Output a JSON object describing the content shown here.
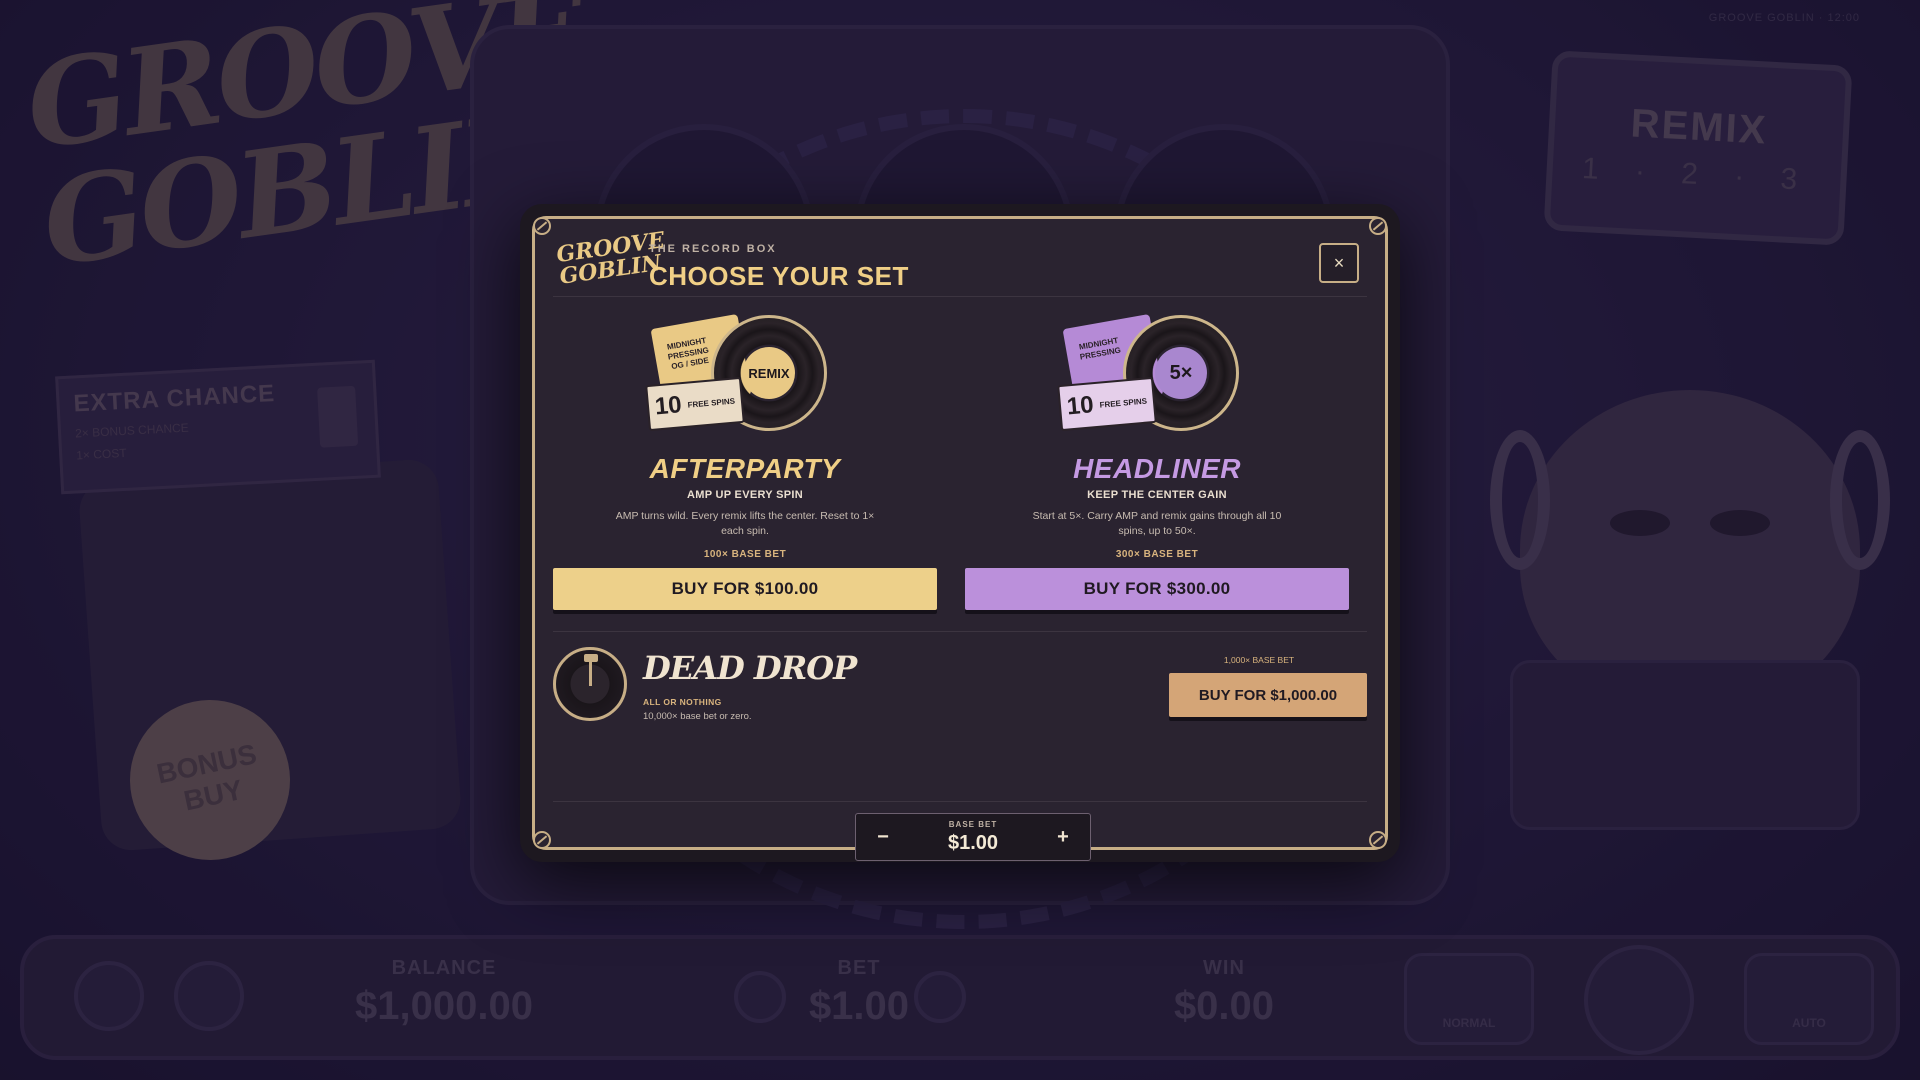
{
  "background": {
    "logo": "GROOVE GOBLIN",
    "extra_chance": {
      "title": "EXTRA CHANCE",
      "line1": "2× BONUS CHANCE",
      "line2": "1× COST"
    },
    "remix_panel": {
      "title": "REMIX",
      "steps": "1 · 2 · 3"
    },
    "bonus_buy": "BONUS BUY",
    "top_right": "GROOVE GOBLIN  ·  12:00",
    "hud": {
      "balance_label": "BALANCE",
      "balance_value": "$1,000.00",
      "bet_label": "BET",
      "bet_value": "$1.00",
      "win_label": "WIN",
      "win_value": "$0.00",
      "normal_label": "NORMAL",
      "auto_label": "AUTO"
    }
  },
  "modal": {
    "logo_text": "GROOVE GOBLIN",
    "subtitle": "THE RECORD BOX",
    "title": "CHOOSE YOUR SET",
    "close_icon": "×",
    "colors": {
      "gold": "#f0cf86",
      "lavender": "#c59ae3",
      "tan": "#d4a577",
      "frame": "#c7ae86"
    },
    "options": [
      {
        "id": "afterparty",
        "sleeve_text": "MIDNIGHT PRESSING OG / SIDE",
        "record_label": "REMIX",
        "tag_count": "10",
        "tag_label": "FREE SPINS",
        "title": "AFTERPARTY",
        "subtitle": "AMP UP EVERY SPIN",
        "description": "AMP turns wild. Every remix lifts the center. Reset to 1× each spin.",
        "multiplier": "100× BASE BET",
        "button": "BUY FOR $100.00"
      },
      {
        "id": "headliner",
        "sleeve_text": "MIDNIGHT PRESSING",
        "record_label": "5×",
        "tag_count": "10",
        "tag_label": "FREE SPINS",
        "title": "HEADLINER",
        "subtitle": "KEEP THE CENTER GAIN",
        "description": "Start at 5×. Carry AMP and remix gains through all 10 spins, up to 50×.",
        "multiplier": "300× BASE BET",
        "button": "BUY FOR $300.00"
      }
    ],
    "dead_drop": {
      "title": "DEAD DROP",
      "subtitle": "ALL OR NOTHING",
      "description": "10,000× base bet or zero.",
      "multiplier": "1,000× BASE BET",
      "button": "BUY FOR $1,000.00"
    },
    "base_bet": {
      "label": "BASE BET",
      "value": "$1.00",
      "minus": "−",
      "plus": "+"
    }
  }
}
